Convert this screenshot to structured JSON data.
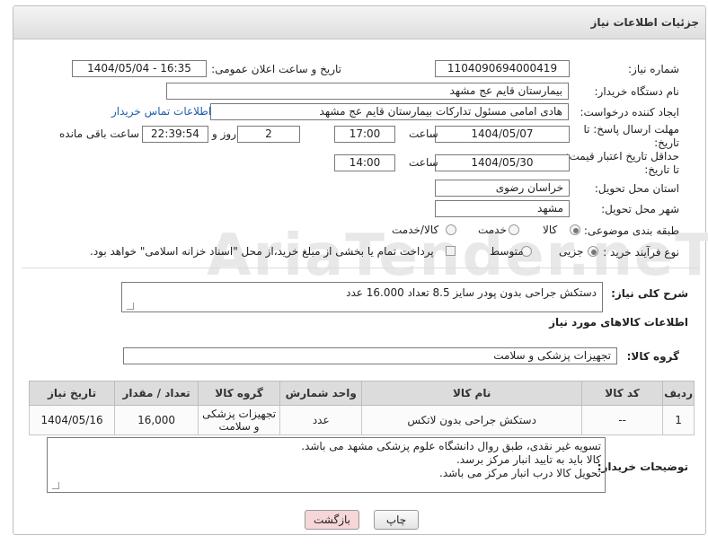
{
  "page": {
    "title": "جزئیات اطلاعات نیاز"
  },
  "watermark": "AriaTender.neT",
  "fields": {
    "need_number": {
      "label": "شماره نیاز:",
      "value": "1104090694000419"
    },
    "announce_datetime": {
      "label": "تاریخ و ساعت اعلان عمومی:",
      "value": "1404/05/04 - 16:35"
    },
    "buyer_org": {
      "label": "نام دستگاه خریدار:",
      "value": "بیمارستان قایم  عج  مشهد"
    },
    "requester": {
      "label": "ایجاد کننده درخواست:",
      "value": "هادی امامی مسئول تدارکات بیمارستان قایم  عج  مشهد",
      "contact_link": "اطلاعات تماس خریدار"
    },
    "reply_deadline": {
      "label_line1": "مهلت ارسال پاسخ: تا",
      "label_line2": "تاریخ:",
      "date": "1404/05/07",
      "time_label": "ساعت",
      "time": "17:00",
      "days": "2",
      "days_label": "روز و",
      "remaining": "22:39:54",
      "remaining_label": "ساعت باقی مانده"
    },
    "price_validity": {
      "label_line1": "حداقل تاریخ اعتبار قیمت:",
      "label_line2": "تا تاریخ:",
      "date": "1404/05/30",
      "time_label": "ساعت",
      "time": "14:00"
    },
    "delivery_province": {
      "label": "استان محل تحویل:",
      "value": "خراسان رضوی"
    },
    "delivery_city": {
      "label": "شهر محل تحویل:",
      "value": "مشهد"
    },
    "category": {
      "label": "طبقه بندی موضوعی:",
      "options": [
        "کالا",
        "خدمت",
        "کالا/خدمت"
      ],
      "selected": "کالا"
    },
    "purchase_type": {
      "label": "نوع فرآیند خرید :",
      "options": [
        "جزیی",
        "متوسط"
      ],
      "selected": "جزیی",
      "note": "پرداخت تمام یا بخشی از مبلغ خرید،از محل \"اسناد خزانه اسلامی\" خواهد بود."
    }
  },
  "description": {
    "label": "شرح کلی نیاز:",
    "value": "دستکش جراحی بدون پودر سایز 8.5 تعداد 16.000 عدد"
  },
  "goods_section": {
    "title": "اطلاعات کالاهای مورد نیاز",
    "group_label": "گروه کالا:",
    "group_value": "تجهیزات پزشکی و سلامت"
  },
  "items_table": {
    "headers": [
      "ردیف",
      "کد کالا",
      "نام کالا",
      "واحد شمارش",
      "گروه کالا",
      "تعداد / مقدار",
      "تاریخ نیاز"
    ],
    "rows": [
      [
        "1",
        "--",
        "دستکش جراحی بدون لاتکس",
        "عدد",
        "تجهیزات پزشکی و سلامت",
        "16,000",
        "1404/05/16"
      ]
    ]
  },
  "buyer_notes": {
    "label": "توضیحات خریدار:",
    "lines": [
      "تسویه غیر نقدی، طبق روال دانشگاه علوم پزشکی مشهد می باشد.",
      "کالا باید به تایید انبار مرکز برسد.",
      "تحویل کالا درب انبار مرکز می باشد."
    ]
  },
  "buttons": {
    "print": "چاپ",
    "back": "بازگشت"
  }
}
